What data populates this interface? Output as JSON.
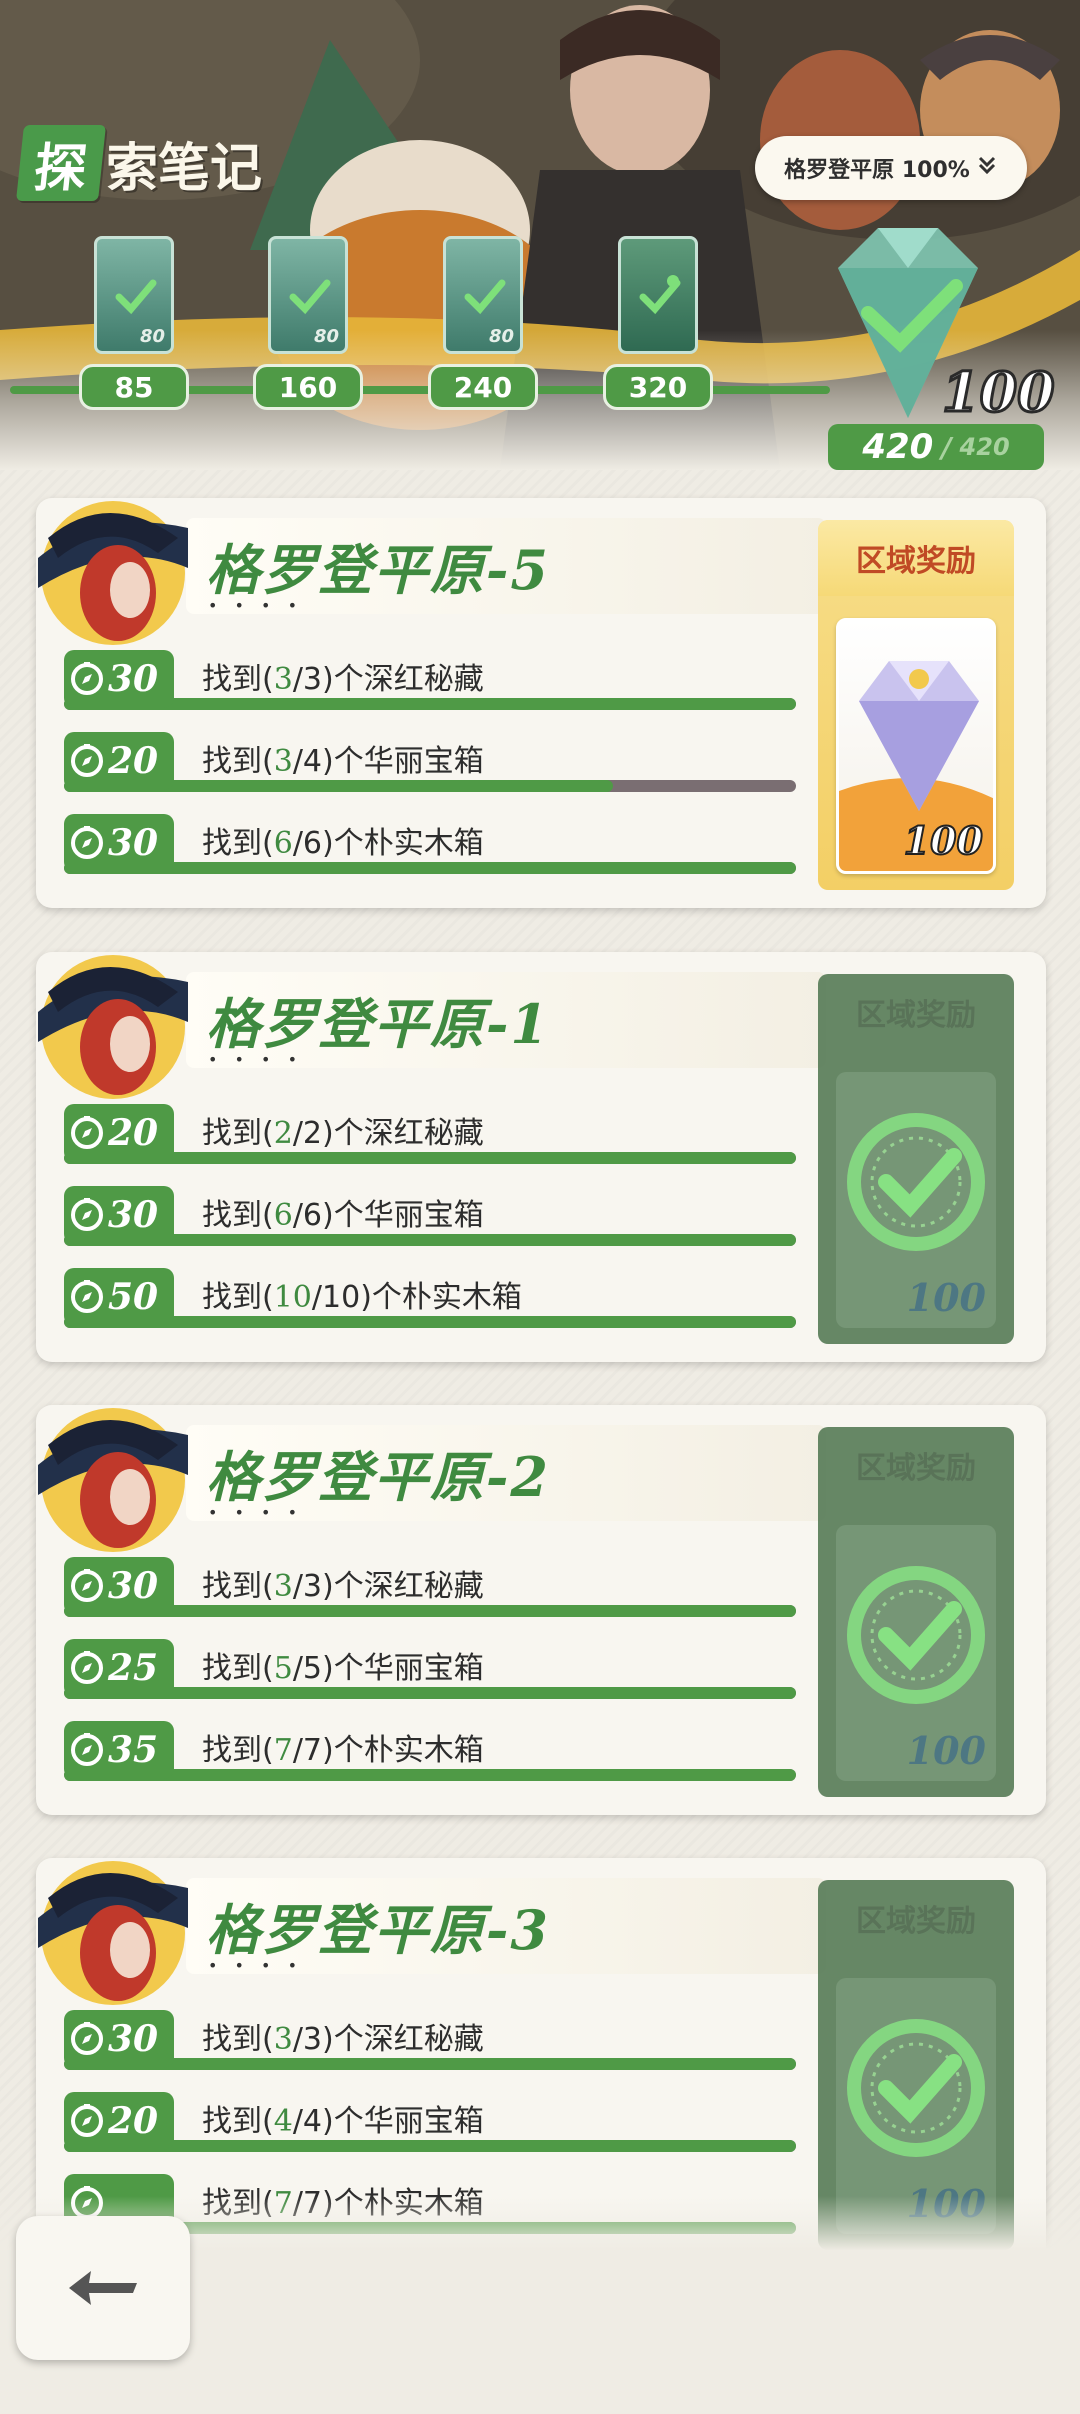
{
  "header": {
    "title_badge": "探",
    "title_rest": "索笔记",
    "region_select": "格罗登平原 100%",
    "milestones": [
      {
        "label": "85",
        "icon": "chest-check-icon",
        "badge": "80"
      },
      {
        "label": "160",
        "icon": "chest-check-icon",
        "badge": "80"
      },
      {
        "label": "240",
        "icon": "chest-check-icon",
        "badge": "80"
      },
      {
        "label": "320",
        "icon": "sprout-check-icon",
        "badge": ""
      }
    ],
    "final_reward_qty": "100",
    "progress_current": "420",
    "progress_separator": "/",
    "progress_max": "420"
  },
  "cards": [
    {
      "title": "格罗登平原-5",
      "stars": "• • • •",
      "reward_label": "区域奖励",
      "reward_qty": "100",
      "reward_state": "active",
      "tasks": [
        {
          "reward": "30",
          "pre": "找到(",
          "count": "3",
          "slash": "/",
          "total": "3",
          "post": ")个深红秘藏",
          "progress": 1.0
        },
        {
          "reward": "20",
          "pre": "找到(",
          "count": "3",
          "slash": "/",
          "total": "4",
          "post": ")个华丽宝箱",
          "progress": 0.75
        },
        {
          "reward": "30",
          "pre": "找到(",
          "count": "6",
          "slash": "/",
          "total": "6",
          "post": ")个朴实木箱",
          "progress": 1.0
        }
      ]
    },
    {
      "title": "格罗登平原-1",
      "stars": "• • • •",
      "reward_label": "区域奖励",
      "reward_qty": "100",
      "reward_state": "claimed",
      "tasks": [
        {
          "reward": "20",
          "pre": "找到(",
          "count": "2",
          "slash": "/",
          "total": "2",
          "post": ")个深红秘藏",
          "progress": 1.0
        },
        {
          "reward": "30",
          "pre": "找到(",
          "count": "6",
          "slash": "/",
          "total": "6",
          "post": ")个华丽宝箱",
          "progress": 1.0
        },
        {
          "reward": "50",
          "pre": "找到(",
          "count": "10",
          "slash": "/",
          "total": "10",
          "post": ")个朴实木箱",
          "progress": 1.0
        }
      ]
    },
    {
      "title": "格罗登平原-2",
      "stars": "• • • •",
      "reward_label": "区域奖励",
      "reward_qty": "100",
      "reward_state": "claimed",
      "tasks": [
        {
          "reward": "30",
          "pre": "找到(",
          "count": "3",
          "slash": "/",
          "total": "3",
          "post": ")个深红秘藏",
          "progress": 1.0
        },
        {
          "reward": "25",
          "pre": "找到(",
          "count": "5",
          "slash": "/",
          "total": "5",
          "post": ")个华丽宝箱",
          "progress": 1.0
        },
        {
          "reward": "35",
          "pre": "找到(",
          "count": "7",
          "slash": "/",
          "total": "7",
          "post": ")个朴实木箱",
          "progress": 1.0
        }
      ]
    },
    {
      "title": "格罗登平原-3",
      "stars": "• • • •",
      "reward_label": "区域奖励",
      "reward_qty": "100",
      "reward_state": "claimed",
      "tasks": [
        {
          "reward": "30",
          "pre": "找到(",
          "count": "3",
          "slash": "/",
          "total": "3",
          "post": ")个深红秘藏",
          "progress": 1.0
        },
        {
          "reward": "20",
          "pre": "找到(",
          "count": "4",
          "slash": "/",
          "total": "4",
          "post": ")个华丽宝箱",
          "progress": 1.0
        },
        {
          "reward": "",
          "pre": "找到(",
          "count": "7",
          "slash": "/",
          "total": "7",
          "post": ")个朴实木箱",
          "progress": 1.0
        }
      ]
    }
  ],
  "icons": {
    "back": "back-arrow-icon",
    "task_reward": "compass-icon",
    "dropdown": "double-chevron-down-icon"
  },
  "colors": {
    "accent_green": "#4f9a46",
    "reward_gold": "#f3cf65",
    "reward_title_red": "#c04a25"
  }
}
